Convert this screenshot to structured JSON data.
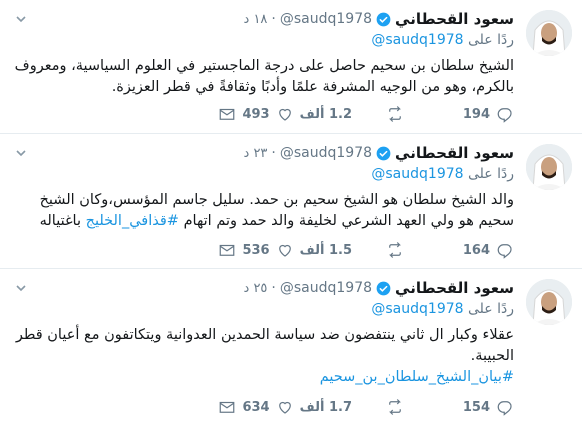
{
  "tweets": [
    {
      "name": "سعود القحطاني",
      "handle": "@saudq1978",
      "time": "١٨ د",
      "reply_prefix": "ردًا على",
      "reply_handle": "@saudq1978",
      "text": "الشيخ سلطان بن سحيم حاصل على درجة الماجستير في العلوم السياسية، ومعروف بالكرم، وهو من الوجيه المشرفة علمًا وأدبًا وثقافةً في قطر العزيزة.",
      "hashtag": "",
      "replies": "194",
      "retweets": "1.2 ألف",
      "likes": "493"
    },
    {
      "name": "سعود القحطاني",
      "handle": "@saudq1978",
      "time": "٢٣ د",
      "reply_prefix": "ردًا على",
      "reply_handle": "@saudq1978",
      "text": "والد الشيخ سلطان هو الشيخ سحيم بن حمد. سليل جاسم المؤسس،وكان الشيخ سحيم هو ولي العهد الشرعي لخليفة والد حمد وتم اتهام",
      "hashtag": "#قذافي_الخليج",
      "text_after": "باغتياله",
      "replies": "164",
      "retweets": "1.5 ألف",
      "likes": "536"
    },
    {
      "name": "سعود القحطاني",
      "handle": "@saudq1978",
      "time": "٢٥ د",
      "reply_prefix": "ردًا على",
      "reply_handle": "@saudq1978",
      "text": "عقلاء وكبار ال ثاني ينتفضون ضد سياسة الحمدين العدوانية ويتكاتفون مع أعيان قطر الحبيبة.",
      "hashtag": "#بيان_الشيخ_سلطان_بن_سحيم",
      "replies": "154",
      "retweets": "1.7 ألف",
      "likes": "634"
    }
  ],
  "icons": {
    "verified": "verified-badge-icon",
    "chevron": "chevron-down-icon",
    "reply": "reply-icon",
    "retweet": "retweet-icon",
    "like": "heart-icon",
    "dm": "envelope-icon"
  },
  "colors": {
    "accent": "#1b95e0",
    "muted": "#657786",
    "text": "#14171a"
  }
}
